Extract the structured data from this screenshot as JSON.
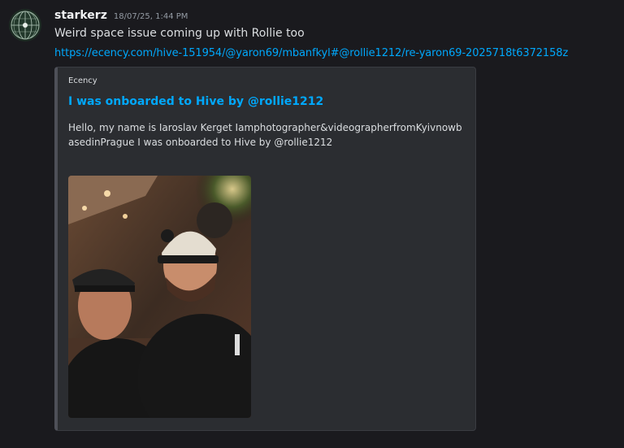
{
  "message": {
    "username": "starkerz",
    "timestamp": "18/07/25, 1:44 PM",
    "text": "Weird space issue coming up with Rollie too",
    "link": "https://ecency.com/hive-151954/@yaron69/mbanfkyl#@rollie1212/re-yaron69-2025718t6372158z"
  },
  "embed": {
    "provider": "Ecency",
    "title": "I was onboarded to Hive by @rollie1212",
    "description": "Hello, my name is Iaroslav Kerget Iamphotographer&videographerfromKyivnowbasedinPrague I was onboarded to Hive by @rollie1212"
  },
  "colors": {
    "background": "#1a1a1e",
    "link": "#00a8fc",
    "embed_background": "#2b2d31"
  }
}
